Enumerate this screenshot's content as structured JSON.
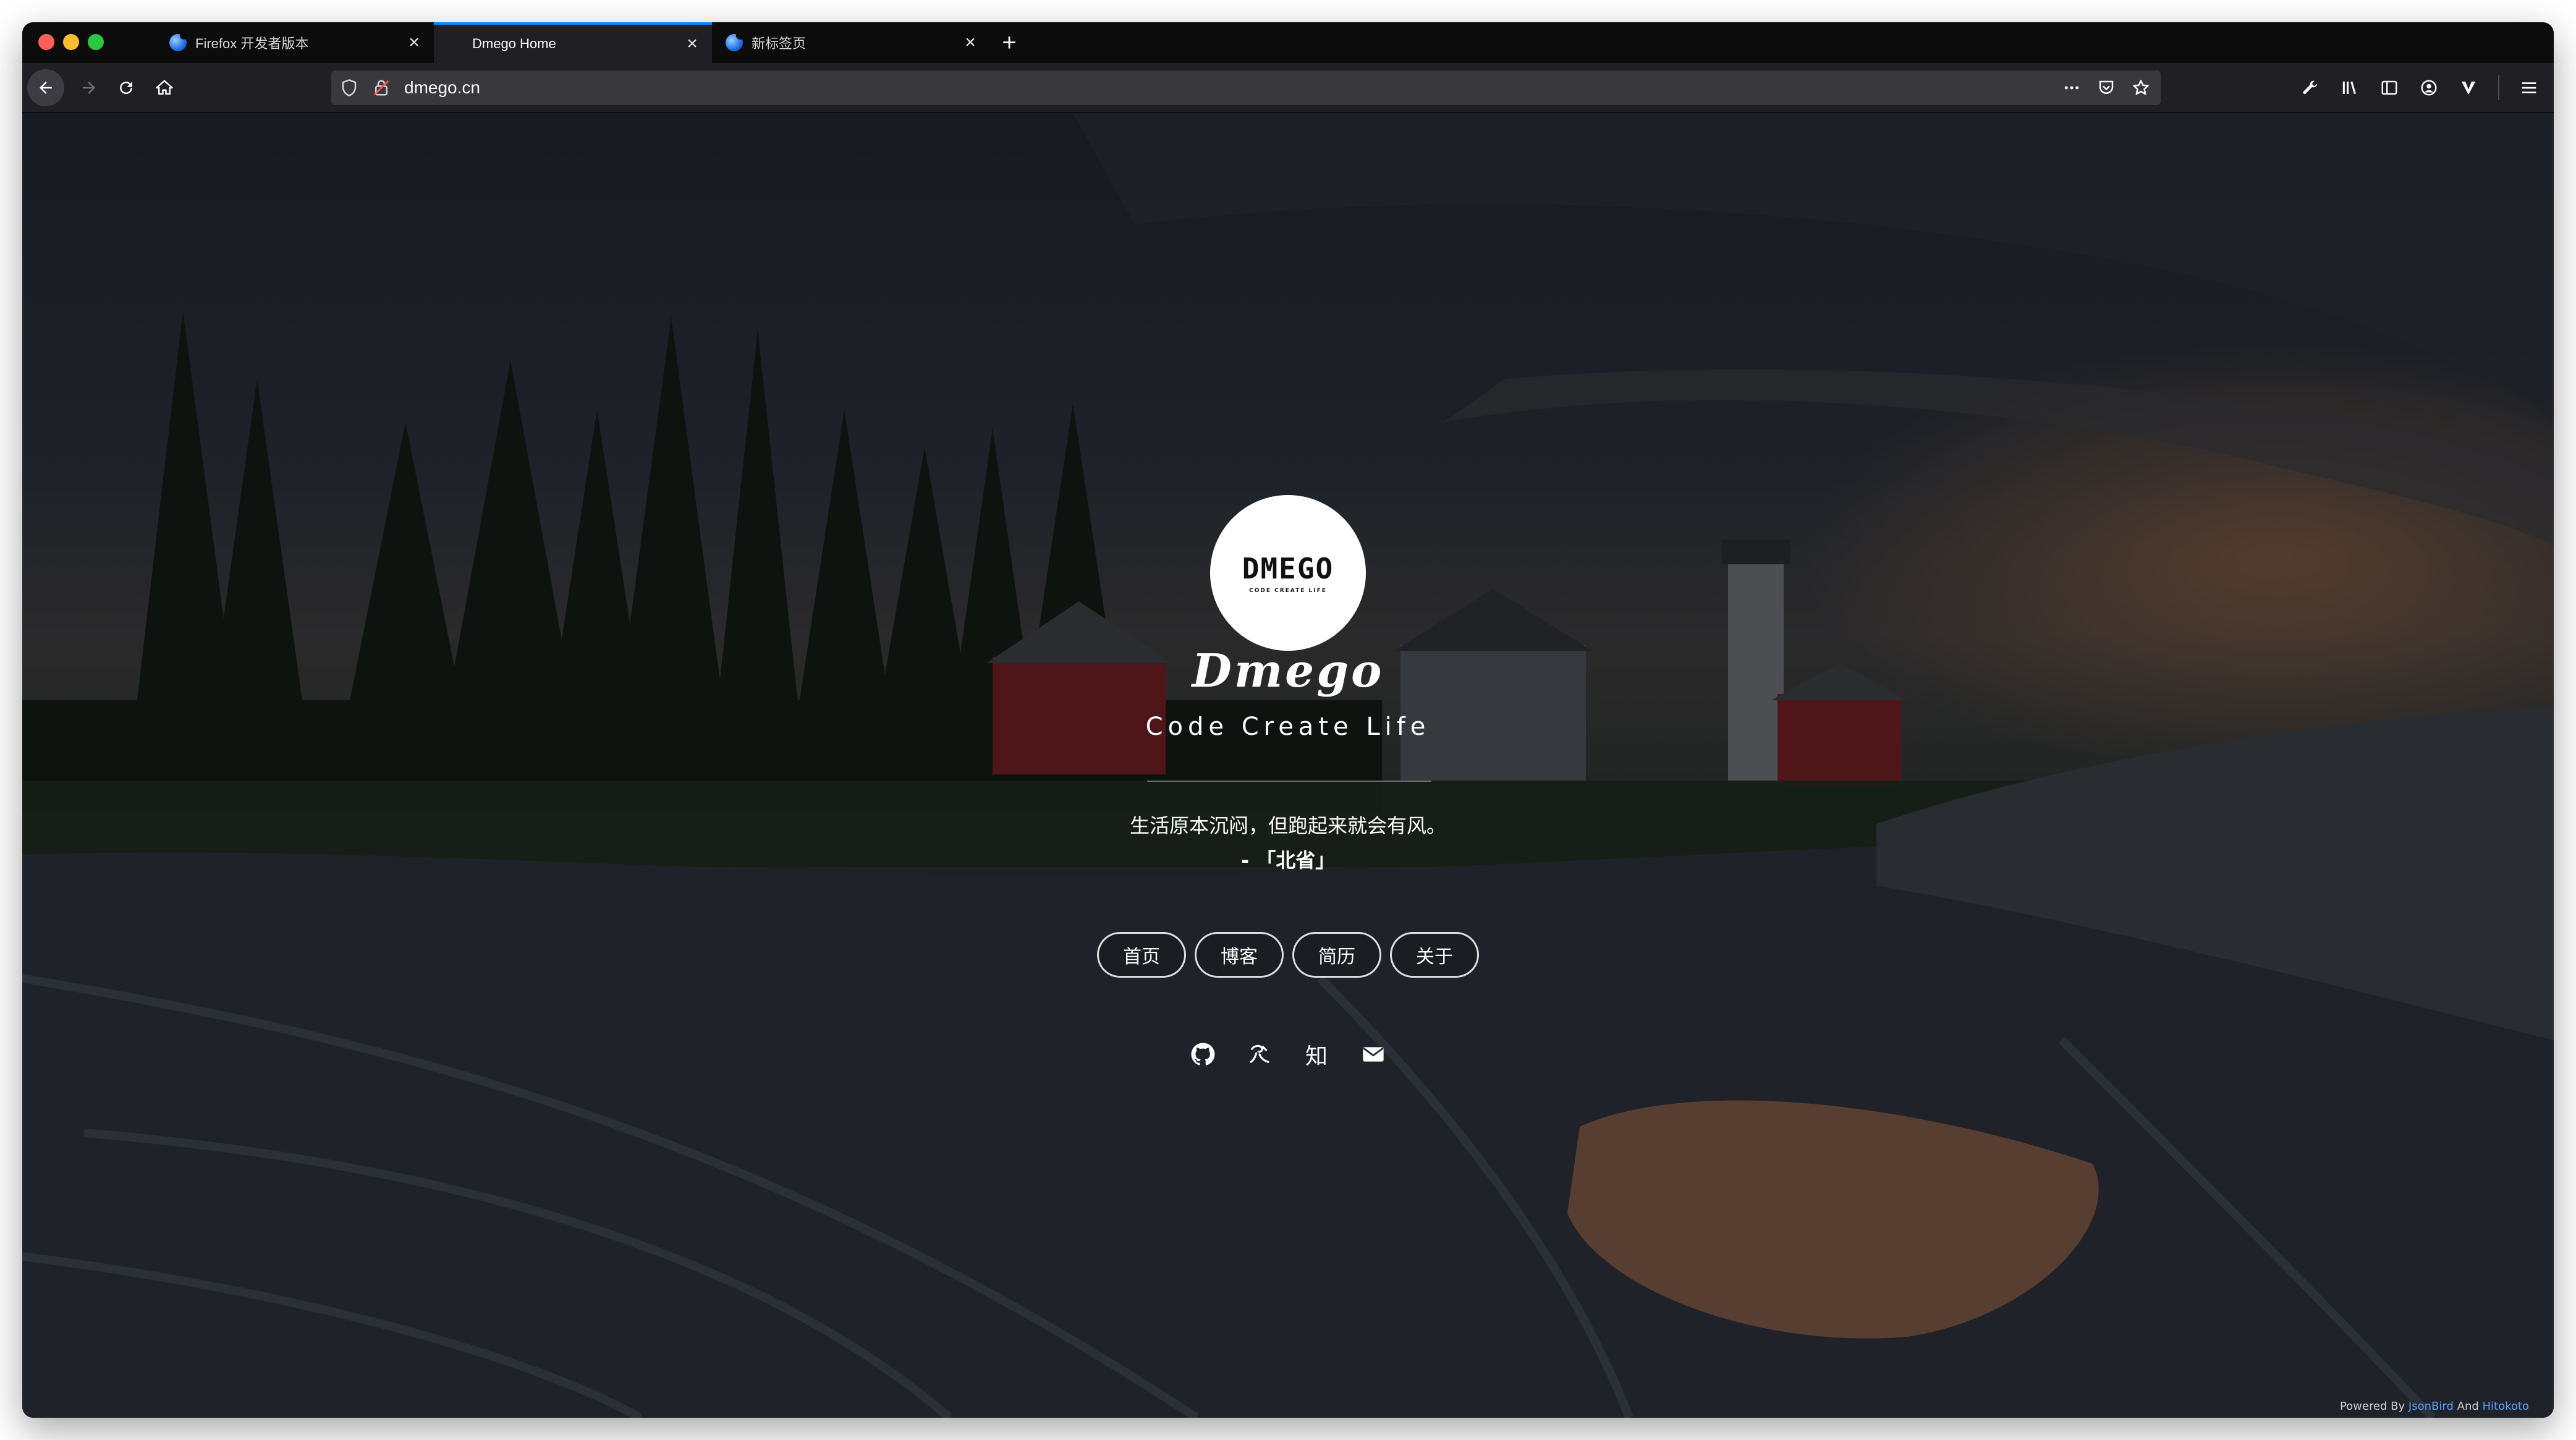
{
  "browser": {
    "tabs": [
      {
        "title": "Firefox 开发者版本",
        "has_favicon": true,
        "active": false
      },
      {
        "title": "Dmego Home",
        "has_favicon": false,
        "active": true
      },
      {
        "title": "新标签页",
        "has_favicon": true,
        "active": false
      }
    ],
    "url": "dmego.cn",
    "accent_color": "#0a84ff"
  },
  "page": {
    "avatar_logo": "DMEGO",
    "avatar_tagline": "CODE CREATE LIFE",
    "title": "Dmego",
    "subtitle": "Code Create Life",
    "quote": "生活原本沉闷，但跑起来就会有风。",
    "quote_author": "- 「北省」",
    "nav": [
      {
        "label": "首页"
      },
      {
        "label": "博客"
      },
      {
        "label": "简历"
      },
      {
        "label": "关于"
      }
    ],
    "social": [
      {
        "icon": "github-icon"
      },
      {
        "icon": "jianshu-icon"
      },
      {
        "icon": "zhihu-icon",
        "label": "知"
      },
      {
        "icon": "mail-icon"
      }
    ],
    "footer": {
      "prefix": "Powered By",
      "link1": "JsonBird",
      "and": "And",
      "link2": "Hitokoto"
    }
  }
}
